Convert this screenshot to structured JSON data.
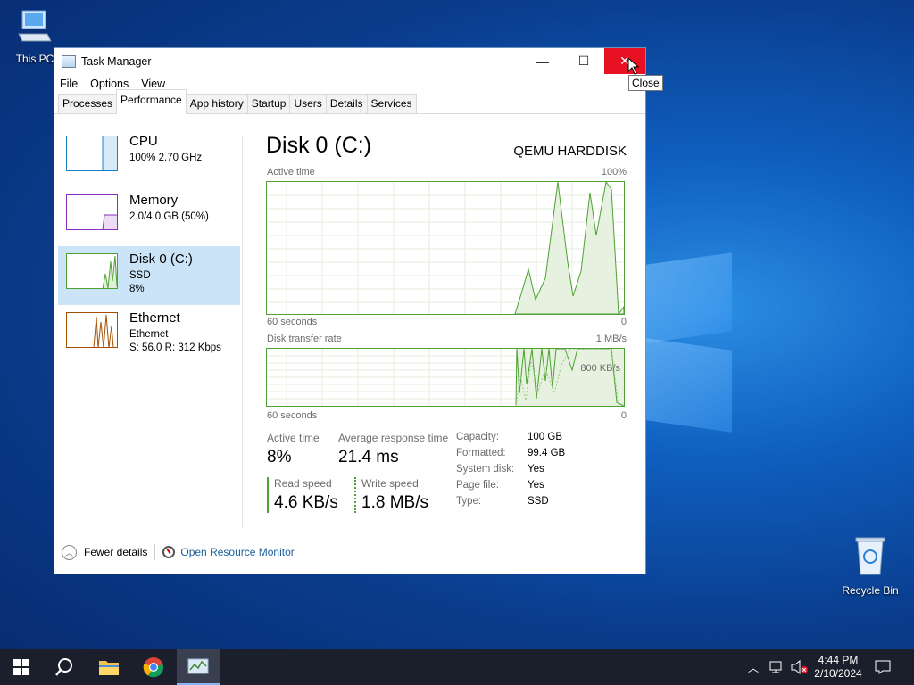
{
  "desktop": {
    "this_pc_label": "This PC",
    "recycle_bin_label": "Recycle Bin"
  },
  "window": {
    "title": "Task Manager",
    "minimize_glyph": "—",
    "maximize_glyph": "☐",
    "close_glyph": "✕",
    "tooltip": "Close"
  },
  "menu": [
    "File",
    "Options",
    "View"
  ],
  "tabs": [
    "Processes",
    "Performance",
    "App history",
    "Startup",
    "Users",
    "Details",
    "Services"
  ],
  "left_list": [
    {
      "name": "CPU",
      "sub1": "100%  2.70 GHz",
      "sub2": "",
      "color": "#1c80c0"
    },
    {
      "name": "Memory",
      "sub1": "2.0/4.0 GB (50%)",
      "sub2": "",
      "color": "#8b2fb8"
    },
    {
      "name": "Disk 0 (C:)",
      "sub1": "SSD",
      "sub2": "8%",
      "color": "#4da033"
    },
    {
      "name": "Ethernet",
      "sub1": "Ethernet",
      "sub2": "S: 56.0  R: 312 Kbps",
      "color": "#a74f01"
    }
  ],
  "detail": {
    "title": "Disk 0 (C:)",
    "model": "QEMU HARDDISK",
    "graph1_label": "Active time",
    "graph1_max": "100%",
    "graph1_time": "60 seconds",
    "graph1_min": "0",
    "graph2_label": "Disk transfer rate",
    "graph2_max": "1 MB/s",
    "graph2_mid": "800 KB/s",
    "graph2_time": "60 seconds",
    "graph2_min": "0",
    "active_time_caption": "Active time",
    "active_time_value": "8%",
    "response_caption": "Average response time",
    "response_value": "21.4 ms",
    "read_caption": "Read speed",
    "read_value": "4.6 KB/s",
    "write_caption": "Write speed",
    "write_value": "1.8 MB/s",
    "properties": [
      {
        "k": "Capacity:",
        "v": "100 GB"
      },
      {
        "k": "Formatted:",
        "v": "99.4 GB"
      },
      {
        "k": "System disk:",
        "v": "Yes"
      },
      {
        "k": "Page file:",
        "v": "Yes"
      },
      {
        "k": "Type:",
        "v": "SSD"
      }
    ]
  },
  "footer": {
    "fewer_details": "Fewer details",
    "open_resource_monitor": "Open Resource Monitor"
  },
  "taskbar": {
    "time": "4:44 PM",
    "date": "2/10/2024"
  },
  "colors": {
    "disk_green": "#4da033",
    "close_red": "#e81123",
    "selection": "#cce4f7"
  }
}
